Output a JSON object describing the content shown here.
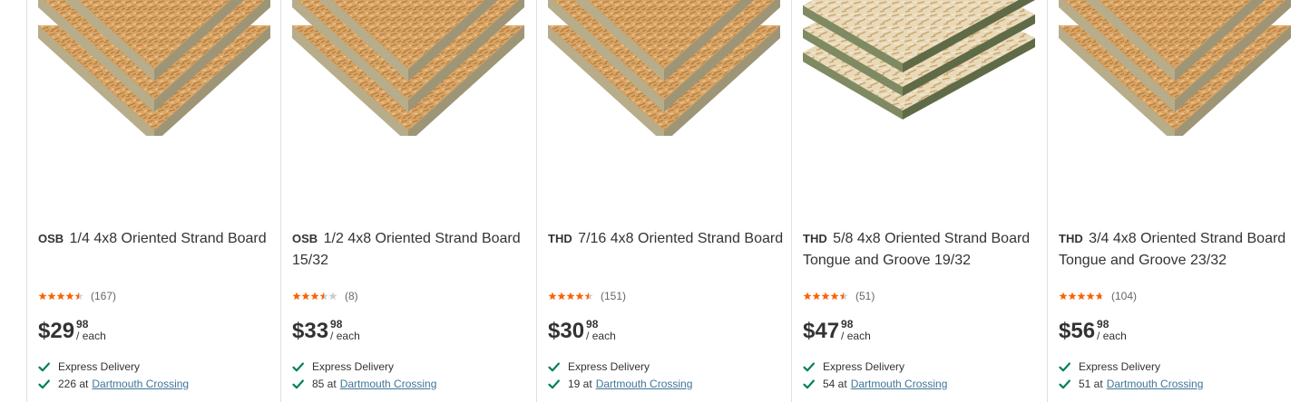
{
  "colors": {
    "star": "#f96302",
    "star_empty": "#cccccc",
    "check": "#00805a",
    "link": "#3e7697"
  },
  "products": [
    {
      "brand": "OSB",
      "name": "1/4 4x8 Oriented Strand Board",
      "rating": 4.5,
      "reviews": "(167)",
      "price_dollars": "$29",
      "price_cents": "98",
      "price_unit": "/ each",
      "express": "Express Delivery",
      "store_count": "226 at",
      "store_name": "Dartmouth Crossing",
      "image": "stacked-osb-board"
    },
    {
      "brand": "OSB",
      "name": "1/2 4x8 Oriented Strand Board 15/32",
      "rating": 3.5,
      "reviews": "(8)",
      "price_dollars": "$33",
      "price_cents": "98",
      "price_unit": "/ each",
      "express": "Express Delivery",
      "store_count": "85 at",
      "store_name": "Dartmouth Crossing",
      "image": "stacked-osb-board"
    },
    {
      "brand": "THD",
      "name": "7/16 4x8 Oriented Strand Board",
      "rating": 4.5,
      "reviews": "(151)",
      "price_dollars": "$30",
      "price_cents": "98",
      "price_unit": "/ each",
      "express": "Express Delivery",
      "store_count": "19 at",
      "store_name": "Dartmouth Crossing",
      "image": "stacked-osb-board"
    },
    {
      "brand": "THD",
      "name": "5/8 4x8 Oriented Strand Board Tongue and Groove 19/32",
      "rating": 4.5,
      "reviews": "(51)",
      "price_dollars": "$47",
      "price_cents": "98",
      "price_unit": "/ each",
      "express": "Express Delivery",
      "store_count": "54 at",
      "store_name": "Dartmouth Crossing",
      "image": "tongue-groove-osb-board"
    },
    {
      "brand": "THD",
      "name": "3/4 4x8 Oriented Strand Board Tongue and Groove 23/32",
      "rating": 4.7,
      "reviews": "(104)",
      "price_dollars": "$56",
      "price_cents": "98",
      "price_unit": "/ each",
      "express": "Express Delivery",
      "store_count": "51 at",
      "store_name": "Dartmouth Crossing",
      "image": "stacked-osb-board"
    }
  ]
}
